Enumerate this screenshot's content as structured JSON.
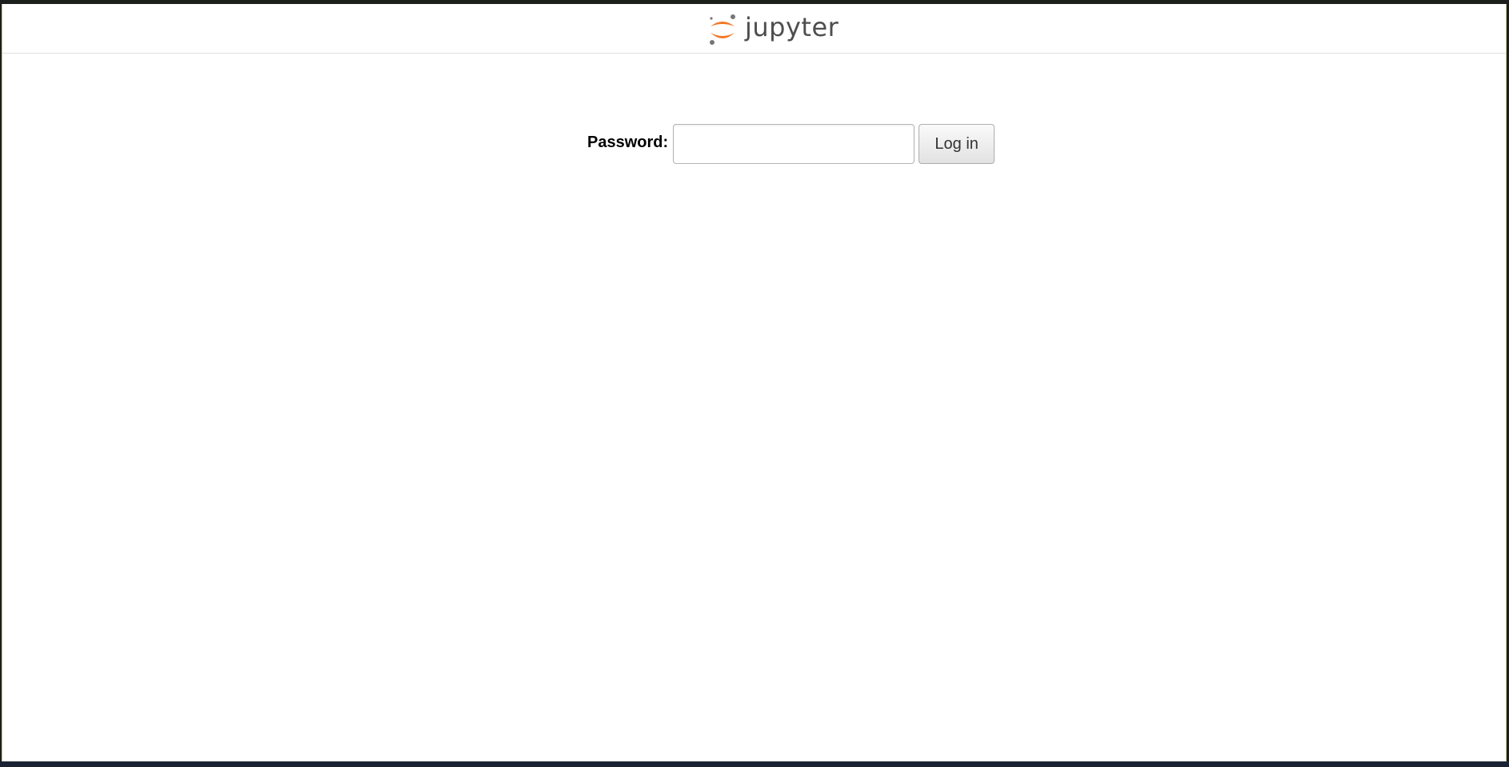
{
  "header": {
    "logo_icon": "jupyter-logo-icon",
    "logo_text": "jupyter"
  },
  "login": {
    "password_label": "Password:",
    "password_value": "",
    "login_button_label": "Log in"
  },
  "colors": {
    "logo_orange": "#f37726",
    "logo_grey": "#767677",
    "logo_text": "#4e4e4e"
  }
}
